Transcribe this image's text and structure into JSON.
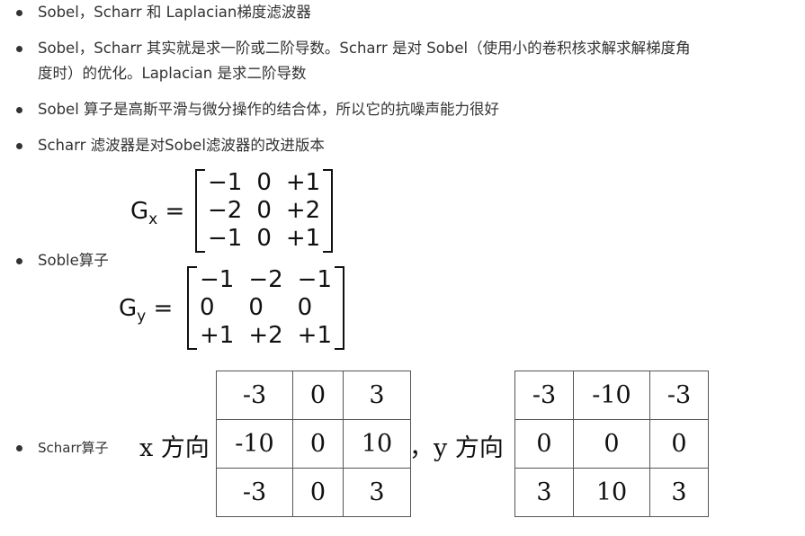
{
  "bullets": [
    "Sobel，Scharr 和 Laplacian梯度滤波器",
    "Sobel，Scharr 其实就是求一阶或二阶导数。Scharr 是对 Sobel（使用小的卷积核求解求解梯度角",
    "度时）的优化。Laplacian 是求二阶导数",
    "Sobel 算子是高斯平滑与微分操作的结合体，所以它的抗噪声能力很好",
    "Scharr 滤波器是对Sobel滤波器的改进版本",
    "Soble算子",
    "Scharr算子"
  ],
  "sobel": {
    "gx_label": "G",
    "gx_sub": "x",
    "gy_label": "G",
    "gy_sub": "y",
    "eq": "=",
    "gx": [
      [
        "−1",
        "0",
        "+1"
      ],
      [
        "−2",
        "0",
        "+2"
      ],
      [
        "−1",
        "0",
        "+1"
      ]
    ],
    "gy": [
      [
        "−1",
        "−2",
        "−1"
      ],
      [
        "0",
        "0",
        "0"
      ],
      [
        "+1",
        "+2",
        "+1"
      ]
    ]
  },
  "scharr": {
    "x_label": "x 方向",
    "y_label": "，y 方向",
    "x": [
      [
        "-3",
        "0",
        "3"
      ],
      [
        "-10",
        "0",
        "10"
      ],
      [
        "-3",
        "0",
        "3"
      ]
    ],
    "y": [
      [
        "-3",
        "-10",
        "-3"
      ],
      [
        "0",
        "0",
        "0"
      ],
      [
        "3",
        "10",
        "3"
      ]
    ]
  }
}
